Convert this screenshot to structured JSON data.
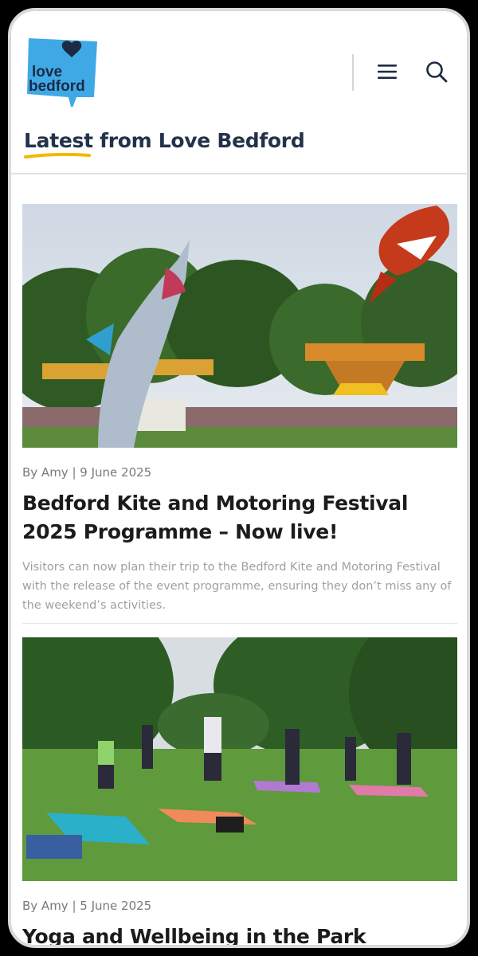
{
  "header": {
    "logo_text_line1": "love",
    "logo_text_line2": "bedford",
    "menu_icon": "hamburger-menu-icon",
    "search_icon": "search-icon"
  },
  "section": {
    "title": "Latest from Love Bedford"
  },
  "colors": {
    "logo_blue": "#3fa9e6",
    "heading": "#23324a",
    "underline": "#f5b800",
    "meta": "#7a7a7a",
    "excerpt": "#a0a0a0"
  },
  "articles": [
    {
      "meta": "By Amy | 9 June 2025",
      "title": "Bedford Kite and Motoring Festival 2025 Programme – Now live!",
      "excerpt": "Visitors can now plan their trip to the Bedford Kite and Motoring Festival with the release of the event programme, ensuring they don’t miss any of the weekend’s activities."
    },
    {
      "meta": "By Amy | 5 June 2025",
      "title": "Yoga and Wellbeing in the Park Returns"
    }
  ]
}
